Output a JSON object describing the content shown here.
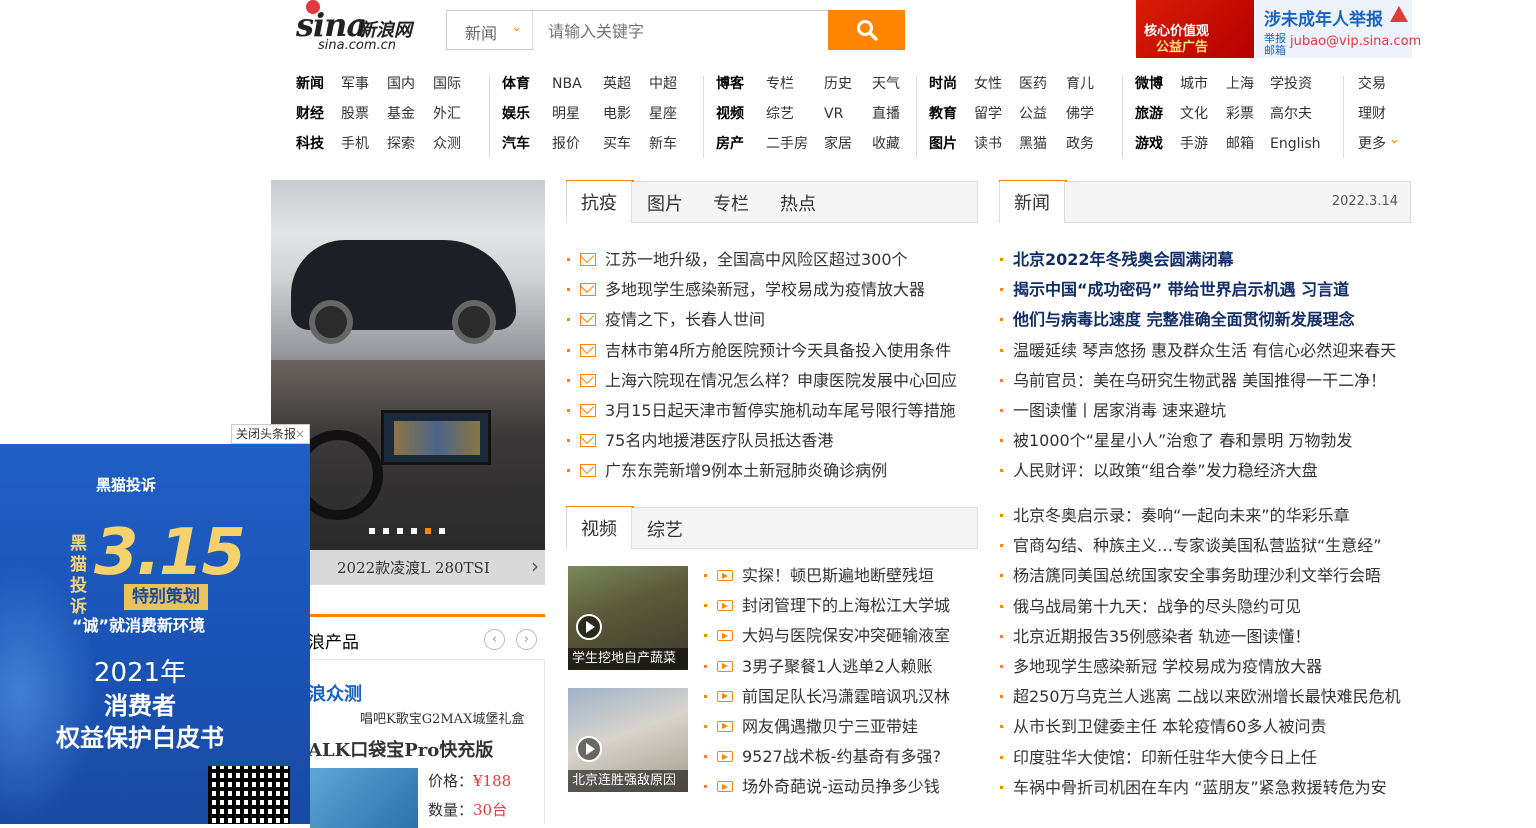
{
  "header": {
    "logo_brand": "sina",
    "logo_cn": "新浪网",
    "logo_url": "sina.com.cn",
    "search_category": "新闻",
    "search_placeholder": "请输入关键字",
    "ad_line1": "核心价值观",
    "ad_line2": "公益广告",
    "report_title": "涉未成年人举报",
    "report_label": "举报\n邮箱",
    "report_email": "jubao@vip.sina.com"
  },
  "nav": {
    "g1": [
      [
        "新闻",
        "军事",
        "国内",
        "国际"
      ],
      [
        "财经",
        "股票",
        "基金",
        "外汇"
      ],
      [
        "科技",
        "手机",
        "探索",
        "众测"
      ]
    ],
    "g2": [
      [
        "体育",
        "NBA",
        "英超",
        "中超"
      ],
      [
        "娱乐",
        "明星",
        "电影",
        "星座"
      ],
      [
        "汽车",
        "报价",
        "买车",
        "新车"
      ]
    ],
    "g3": [
      [
        "博客",
        "专栏",
        "历史",
        "天气"
      ],
      [
        "视频",
        "综艺",
        "VR",
        "直播"
      ],
      [
        "房产",
        "二手房",
        "家居",
        "收藏"
      ]
    ],
    "g4": [
      [
        "时尚",
        "女性",
        "医药",
        "育儿"
      ],
      [
        "教育",
        "留学",
        "公益",
        "佛学"
      ],
      [
        "图片",
        "读书",
        "黑猫",
        "政务"
      ]
    ],
    "g5": [
      [
        "微博",
        "城市",
        "上海",
        "学投资"
      ],
      [
        "旅游",
        "文化",
        "彩票",
        "高尔夫"
      ],
      [
        "游戏",
        "手游",
        "邮箱",
        "English"
      ]
    ],
    "g6": [
      "交易",
      "理财",
      "更多"
    ]
  },
  "slider": {
    "caption": "2022款凌渡L 280TSI",
    "active_dot": 4,
    "dot_count": 6
  },
  "products": {
    "title": "浪产品",
    "zc": "浪众测",
    "sub": "唱吧K歌宝G2MAX城堡礼盒",
    "name": "ALK口袋宝Pro快充版",
    "price_label": "价格：",
    "price": "¥188",
    "qty_label": "数量：",
    "qty": "30台"
  },
  "ad315": {
    "close": "关闭头条报",
    "brand": "黑猫投诉",
    "vert": "黑猫投诉",
    "big": "3.15",
    "ribbon": "特别策划",
    "cheng": "“诚”就消费新环境",
    "year": "2021年",
    "l2": "消费者",
    "l3": "权益保护白皮书"
  },
  "center": {
    "tabs": [
      "抗疫",
      "图片",
      "专栏",
      "热点"
    ],
    "news": [
      "江苏一地升级，全国高中风险区超过300个",
      "多地现学生感染新冠，学校易成为疫情放大器",
      "疫情之下，长春人世间",
      "吉林市第4所方舱医院预计今天具备投入使用条件",
      "上海六院现在情况怎么样？申康医院发展中心回应",
      "3月15日起天津市暂停实施机动车尾号限行等措施",
      "75名内地援港医疗队员抵达香港",
      "广东东莞新增9例本土新冠肺炎确诊病例"
    ],
    "video_tabs": [
      "视频",
      "综艺"
    ],
    "thumbs": [
      "学生挖地自产蔬菜",
      "北京连胜强敌原因"
    ],
    "videos": [
      "实探！顿巴斯遍地断壁残垣",
      "封闭管理下的上海松江大学城",
      "大妈与医院保安冲突砸输液室",
      "3男子聚餐1人逃单2人赖账",
      "前国足队长冯潇霆暗讽巩汉林",
      "网友偶遇撒贝宁三亚带娃",
      "9527战术板-约基奇有多强?",
      "场外奇葩说-运动员挣多少钱"
    ]
  },
  "right": {
    "tab": "新闻",
    "date": "2022.3.14",
    "headlines": [
      "北京2022年冬残奥会圆满闭幕",
      "揭示中国“成功密码” 带给世界启示机遇 习言道",
      "他们与病毒比速度 完整准确全面贯彻新发展理念"
    ],
    "news1": [
      "温暖延续 琴声悠扬 惠及群众生活 有信心必然迎来春天",
      "乌前官员：美在乌研究生物武器 美国推得一干二净！",
      "一图读懂丨居家消毒 速来避坑",
      "被1000个“星星小人”治愈了 春和景明 万物勃发",
      "人民财评：以政策“组合拳”发力稳经济大盘"
    ],
    "news2": [
      "北京冬奥启示录：奏响“一起向未来”的华彩乐章",
      "官商勾结、种族主义…专家谈美国私营监狱“生意经”",
      "杨洁篪同美国总统国家安全事务助理沙利文举行会晤",
      "俄乌战局第十九天：战争的尽头隐约可见",
      "北京近期报告35例感染者 轨迹一图读懂！",
      "多地现学生感染新冠 学校易成为疫情放大器",
      "超250万乌克兰人逃离 二战以来欧洲增长最快难民危机",
      "从市长到卫健委主任 本轮疫情60多人被问责",
      "印度驻华大使馆：印新任驻华大使今日上任",
      "车祸中骨折司机困在车内 “蓝朋友”紧急救援转危为安"
    ]
  },
  "colors": {
    "accent": "#ff8400",
    "link_blue": "#122e67",
    "ad_blue": "#1f5fc6"
  }
}
